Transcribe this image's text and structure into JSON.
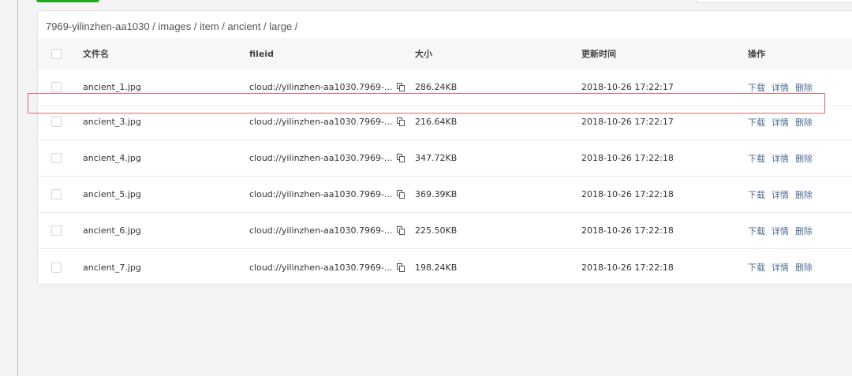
{
  "breadcrumb": "7969-yilinzhen-aa1030 / images / item / ancient / large /",
  "table": {
    "headers": {
      "filename": "文件名",
      "fileid": "fileid",
      "size": "大小",
      "updated": "更新时间",
      "actions": "操作"
    },
    "action_labels": {
      "download": "下载",
      "details": "详情",
      "delete": "删除"
    },
    "rows": [
      {
        "filename": "ancient_1.jpg",
        "fileid": "cloud://yilinzhen-aa1030.7969-...",
        "size": "286.24KB",
        "updated": "2018-10-26 17:22:17"
      },
      {
        "filename": "ancient_3.jpg",
        "fileid": "cloud://yilinzhen-aa1030.7969-...",
        "size": "216.64KB",
        "updated": "2018-10-26 17:22:17"
      },
      {
        "filename": "ancient_4.jpg",
        "fileid": "cloud://yilinzhen-aa1030.7969-...",
        "size": "347.72KB",
        "updated": "2018-10-26 17:22:18"
      },
      {
        "filename": "ancient_5.jpg",
        "fileid": "cloud://yilinzhen-aa1030.7969-...",
        "size": "369.39KB",
        "updated": "2018-10-26 17:22:18"
      },
      {
        "filename": "ancient_6.jpg",
        "fileid": "cloud://yilinzhen-aa1030.7969-...",
        "size": "225.50KB",
        "updated": "2018-10-26 17:22:18"
      },
      {
        "filename": "ancient_7.jpg",
        "fileid": "cloud://yilinzhen-aa1030.7969-...",
        "size": "198.24KB",
        "updated": "2018-10-26 17:22:18"
      }
    ]
  },
  "colors": {
    "accent_green": "#1aad19",
    "action_link": "#4c6b94",
    "highlight_border": "#e06b6b"
  }
}
